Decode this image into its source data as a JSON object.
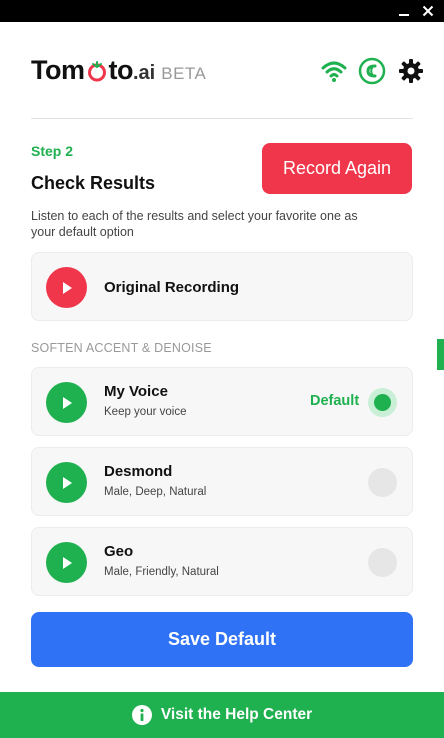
{
  "window": {
    "minimize_glyph": "—",
    "close_glyph": "✕"
  },
  "header": {
    "logo_main": "Tom",
    "logo_tail": "to",
    "logo_ai": ".ai",
    "logo_beta": "BETA",
    "icons": [
      "wifi-icon",
      "headset-icon",
      "gear-icon"
    ]
  },
  "step": {
    "label": "Step 2",
    "title": "Check Results",
    "record_again": "Record Again",
    "description": "Listen to each of the results and select your favorite one as your default option"
  },
  "original": {
    "title": "Original Recording"
  },
  "section_label": "SOFTEN ACCENT & DENOISE",
  "voices": [
    {
      "title": "My Voice",
      "subtitle": "Keep your voice",
      "selected": true,
      "badge": "Default"
    },
    {
      "title": "Desmond",
      "subtitle": "Male, Deep, Natural",
      "selected": false
    },
    {
      "title": "Geo",
      "subtitle": "Male, Friendly, Natural",
      "selected": false
    }
  ],
  "save_button": "Save Default",
  "help": {
    "label": "Visit the Help Center"
  },
  "colors": {
    "accent_green": "#1fb04f",
    "record_red": "#f0364b",
    "save_blue": "#2f72f5"
  }
}
